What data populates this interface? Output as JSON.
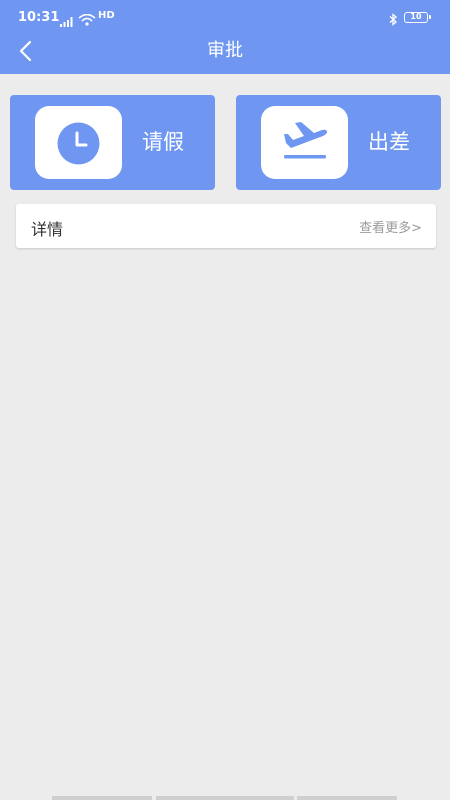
{
  "status_bar": {
    "time": "10:31",
    "hd_label": "HD",
    "battery": "10"
  },
  "header": {
    "title": "审批",
    "background_color": "#6f97f1"
  },
  "cards": [
    {
      "label": "请假",
      "icon": "clock-icon"
    },
    {
      "label": "出差",
      "icon": "airplane-departure-icon"
    }
  ],
  "details": {
    "title": "详情",
    "more_link": "查看更多>"
  }
}
